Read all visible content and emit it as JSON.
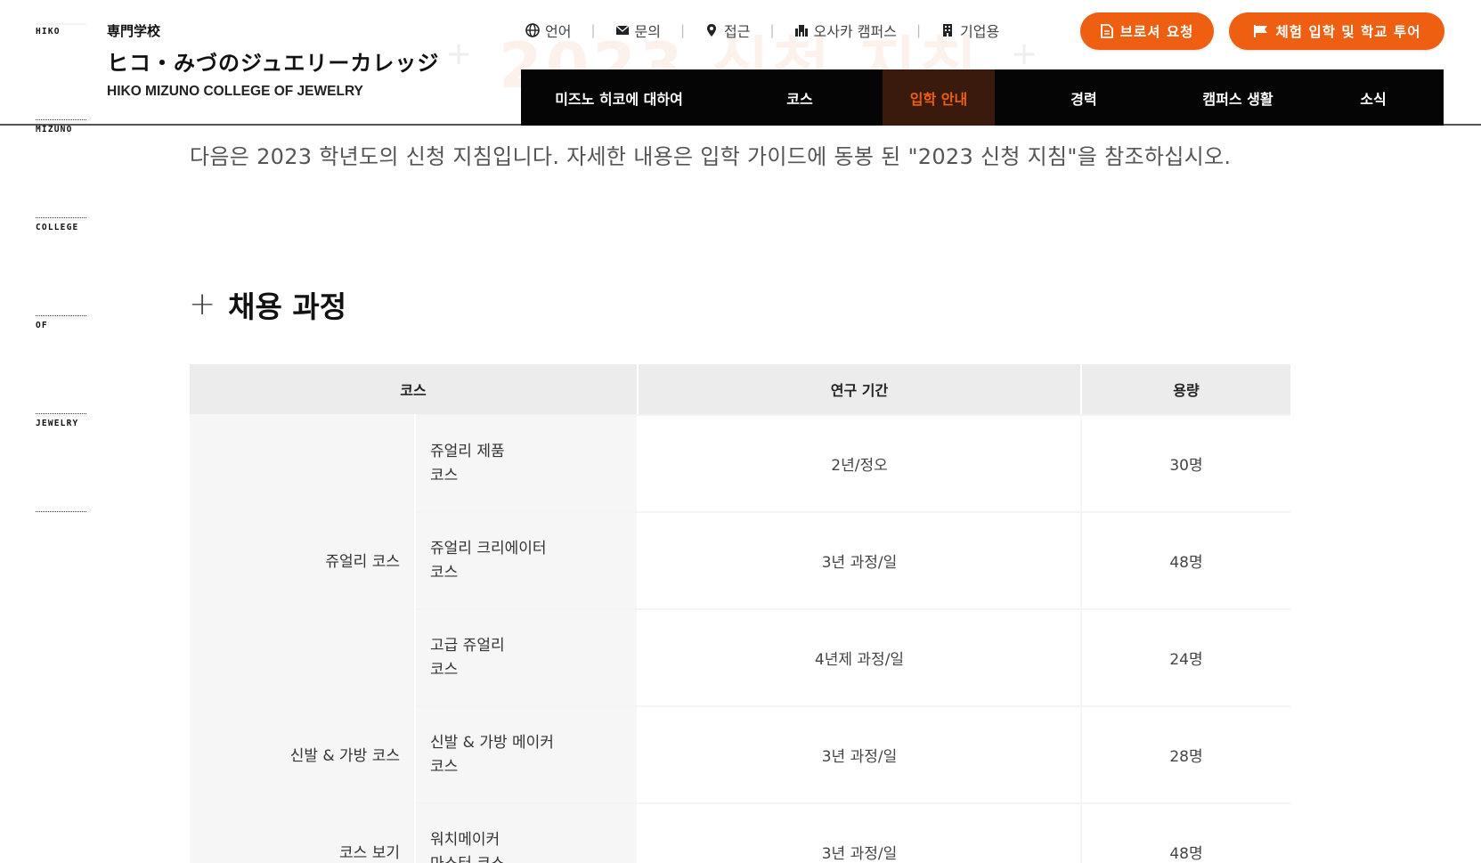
{
  "logo": {
    "mark_rows": [
      "HIKO",
      "MIZUNO",
      "COLLEGE",
      "OF",
      "JEWELRY"
    ],
    "kind": "専門学校",
    "jp_name": "ヒコ・みづのジュエリーカレッジ",
    "en_name": "HIKO MIZUNO COLLEGE OF JEWELRY"
  },
  "watermark": "2023 신청 지침",
  "utility": [
    {
      "icon": "globe-icon",
      "label": "언어"
    },
    {
      "icon": "envelope-icon",
      "label": "문의"
    },
    {
      "icon": "map-pin-icon",
      "label": "접근"
    },
    {
      "icon": "campus-icon",
      "label": "오사카 캠퍼스"
    },
    {
      "icon": "building-icon",
      "label": "기업용"
    }
  ],
  "buttons": {
    "brochure": {
      "icon": "document-icon",
      "label": "브로셔 요청"
    },
    "tour": {
      "icon": "flag-icon",
      "label": "체험 입학 및 학교 투어"
    }
  },
  "nav": [
    {
      "label": "미즈노 히코에 대하여",
      "active": false
    },
    {
      "label": "코스",
      "active": false
    },
    {
      "label": "입학 안내",
      "active": true
    },
    {
      "label": "경력",
      "active": false
    },
    {
      "label": "캠퍼스 생활",
      "active": false
    },
    {
      "label": "소식",
      "active": false
    }
  ],
  "intro": "다음은 2023 학년도의 신청 지침입니다. 자세한 내용은 입학 가이드에 동봉 된 \"2023 신청 지침\"을 참조하십시오.",
  "section_title": "채용 과정",
  "table": {
    "headers": {
      "course": "코스",
      "period": "연구 기간",
      "capacity": "용량"
    },
    "groups": [
      {
        "name": "쥬얼리 코스"
      },
      {
        "name": "신발 & 가방 코스"
      },
      {
        "name": "코스 보기"
      }
    ],
    "rows": [
      {
        "line1": "쥬얼리 제품",
        "line2": "코스",
        "period": "2년/정오",
        "capacity": "30명"
      },
      {
        "line1": "쥬얼리 크리에이터",
        "line2": "코스",
        "period": "3년 과정/일",
        "capacity": "48명"
      },
      {
        "line1": "고급 쥬얼리",
        "line2": "코스",
        "period": "4년제 과정/일",
        "capacity": "24명"
      },
      {
        "line1": "신발 & 가방 메이커",
        "line2": "코스",
        "period": "3년 과정/일",
        "capacity": "28명"
      },
      {
        "line1": "워치메이커",
        "line2": "마스터 코스",
        "period": "3년 과정/일",
        "capacity": "48명"
      }
    ]
  },
  "colors": {
    "accent": "#ee5f11",
    "nav_bg": "#050505",
    "active_bg": "#3a1a0c",
    "header_bg": "#ececec",
    "cell_bg": "#f6f6f6"
  }
}
